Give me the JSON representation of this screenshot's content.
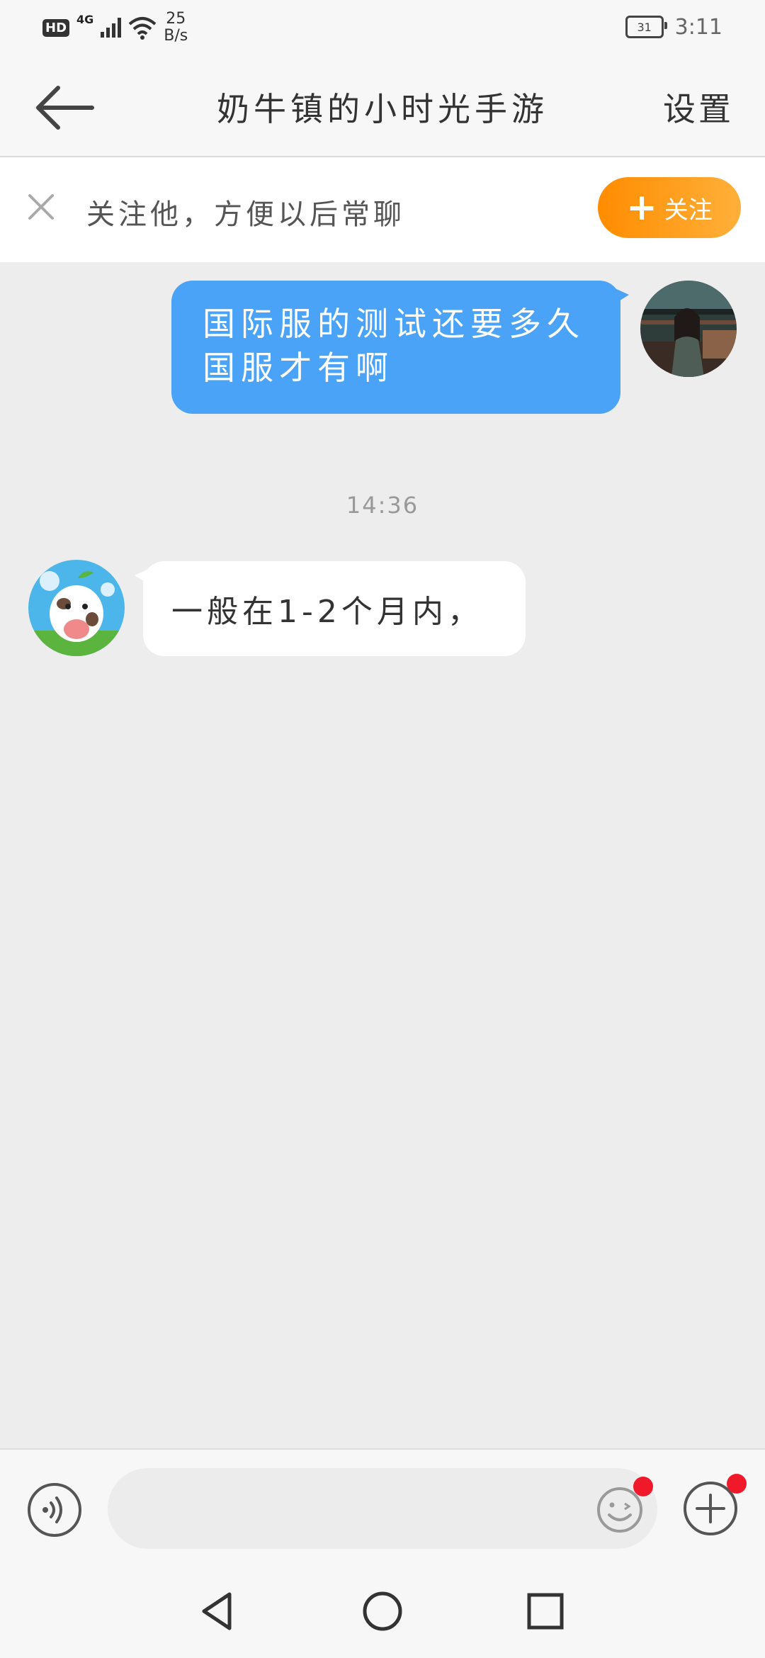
{
  "status_bar": {
    "hd": "HD",
    "network": "4G",
    "speed_value": "25",
    "speed_unit": "B/s",
    "battery": "31",
    "time": "3:11"
  },
  "header": {
    "title": "奶牛镇的小时光手游",
    "settings_label": "设置"
  },
  "follow_banner": {
    "hint": "关注他，方便以后常聊",
    "button_label": "关注"
  },
  "messages": [
    {
      "direction": "outgoing",
      "text_line1": "国际服的测试还要多久",
      "text_line2": "国服才有啊"
    },
    {
      "direction": "incoming",
      "text": "一般在1-2个月内，"
    }
  ],
  "timestamp": "14:36",
  "input_bar": {
    "value": "",
    "placeholder": ""
  },
  "icons": [
    "back-arrow-icon",
    "close-icon",
    "plus-icon",
    "voice-icon",
    "emoji-icon",
    "add-icon",
    "nav-back-icon",
    "nav-home-icon",
    "nav-recents-icon"
  ],
  "colors": {
    "outgoing_bubble": "#4aa3f7",
    "follow_button": "#ff9a1a",
    "badge_dot": "#f0192a"
  }
}
